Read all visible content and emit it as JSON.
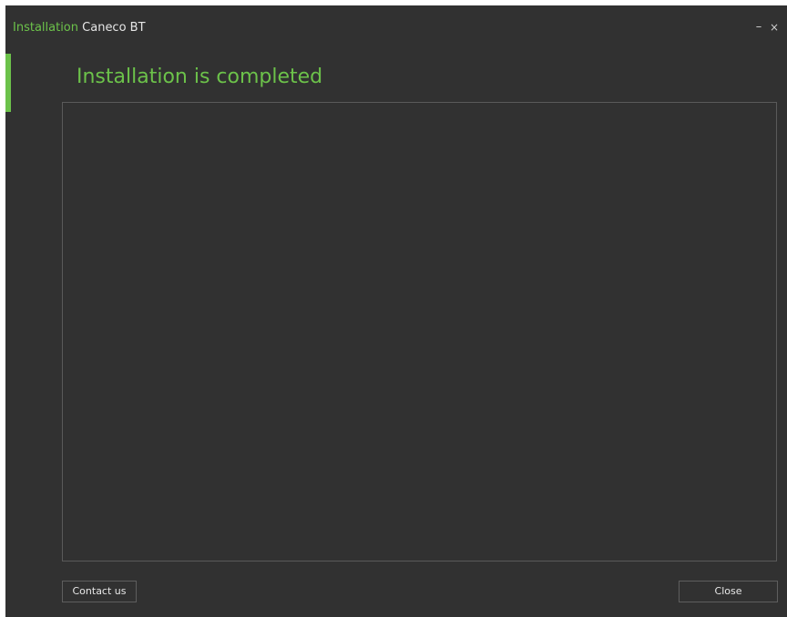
{
  "window": {
    "title_prefix": "Installation",
    "title_product": "Caneco BT",
    "minimize_glyph": "–",
    "close_glyph": "×"
  },
  "main": {
    "heading": "Installation is completed"
  },
  "footer": {
    "contact_label": "Contact us",
    "close_label": "Close"
  },
  "colors": {
    "accent": "#6cc24a",
    "background": "#313131",
    "border": "#5a5a5a",
    "text": "#e6e6e6"
  },
  "icons": {
    "minimize": "minimize-icon",
    "close": "close-icon"
  }
}
